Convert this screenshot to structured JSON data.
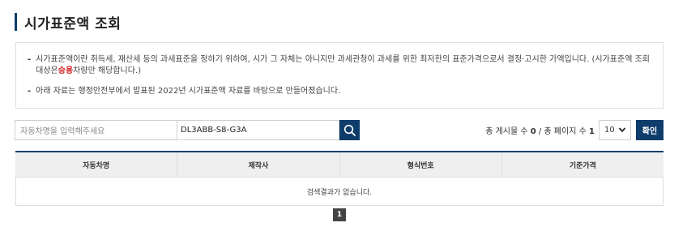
{
  "page": {
    "title": "시가표준액 조회"
  },
  "notice": {
    "item1_before": "시가표준액이란 취득세, 재산세 등의 과세표준을 정하기 위하여, 시가 그 자체는 아니지만 과세관청이 과세를 위한 최저한의 표준가격으로서 결정·고시한 가액입니다. (시가표준액 조회 대상은",
    "item1_accent": "승용",
    "item1_after": "차량만 해당합니다.)",
    "item2": "아래 자료는 행정안전부에서 발표된 2022년 시가표준액 자료를 바탕으로 만들어졌습니다."
  },
  "search": {
    "name_placeholder": "자동차명을 입력해주세요",
    "code_value": "DL3ABB-S8-G3A",
    "button_icon": "search-icon"
  },
  "summary": {
    "total_label": "총 게시물 수",
    "total_count": "0",
    "separator": "/",
    "pages_label": "총 페이지 수",
    "pages_count": "1"
  },
  "page_size": {
    "selected": "10"
  },
  "confirm_label": "확인",
  "table": {
    "headers": [
      "자동차명",
      "제작사",
      "형식번호",
      "기준가격"
    ],
    "empty_message": "검색결과가 없습니다."
  },
  "pagination": {
    "current": "1"
  },
  "colors": {
    "primary": "#0f3d6b",
    "accent": "#d21f1f"
  }
}
